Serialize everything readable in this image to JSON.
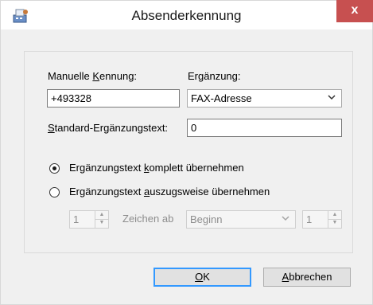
{
  "window": {
    "title": "Absenderkennung",
    "close_glyph": "x",
    "icon": "fax-app-icon"
  },
  "manual_id": {
    "label_pre": "Manuelle ",
    "label_key": "K",
    "label_post": "ennung:",
    "value": "+493328"
  },
  "supplement": {
    "label_pre": "Er",
    "label_key": "g",
    "label_post": "änzung:",
    "selected": "FAX-Adresse"
  },
  "std_text": {
    "label_key": "S",
    "label_post": "tandard-Ergänzungstext:",
    "value": "0"
  },
  "radio_full": {
    "label_pre": "Ergänzungstext ",
    "label_key": "k",
    "label_post": "omplett übernehmen",
    "checked": true
  },
  "radio_partial": {
    "label_pre": "Ergänzungstext ",
    "label_key": "a",
    "label_post": "uszugsweise übernehmen",
    "checked": false
  },
  "partial": {
    "count_value": "1",
    "zeichen_label": "Zeichen ab",
    "from_selected": "Beginn",
    "length_value": "1"
  },
  "buttons": {
    "ok_key": "O",
    "ok_post": "K",
    "cancel_key": "A",
    "cancel_post": "bbrechen"
  }
}
